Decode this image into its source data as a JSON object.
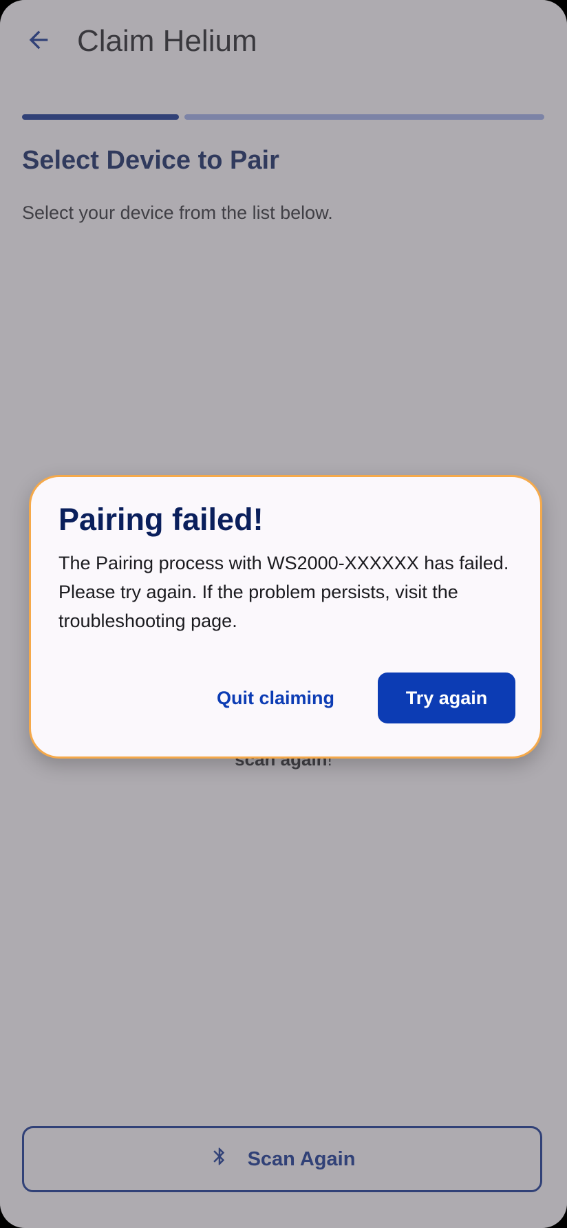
{
  "app_bar": {
    "title": "Claim Helium",
    "back_icon": "arrow-left-icon"
  },
  "progress": {
    "current_step": 1,
    "total_steps": 4
  },
  "step": {
    "heading": "Select Device to Pair",
    "subtitle": "Select your device from the list below."
  },
  "hint": {
    "emphasis": "scan again",
    "suffix": "!"
  },
  "scan_button": {
    "icon": "bluetooth-icon",
    "label": "Scan Again"
  },
  "dialog": {
    "title": "Pairing failed!",
    "body": "The Pairing process with WS2000-XXXXXX has failed. Please try again. If the problem persists, visit the troubleshooting page.",
    "secondary_action": "Quit claiming",
    "primary_action": "Try again"
  },
  "colors": {
    "primary": "#0c2d8f",
    "accent_button": "#0c3cb4",
    "progress_remaining": "#9cabe8",
    "dialog_border": "#f5a94a",
    "heading": "#0a1f5c"
  }
}
